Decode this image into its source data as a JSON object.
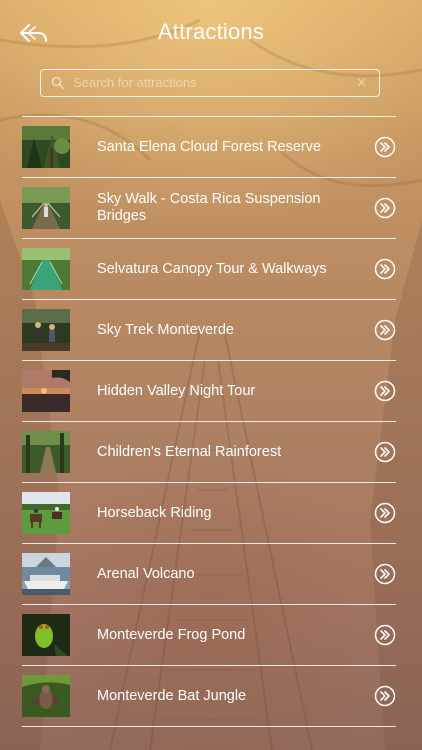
{
  "header": {
    "title": "Attractions",
    "back_icon": "back-arrow-icon"
  },
  "search": {
    "placeholder": "Search for attractions",
    "value": "",
    "icon": "search-icon",
    "clear_icon": "clear-icon"
  },
  "list": {
    "items": [
      {
        "label": "Santa Elena Cloud Forest Reserve",
        "thumb": "cloud-forest-photo"
      },
      {
        "label": "Sky Walk - Costa Rica Suspension Bridges",
        "thumb": "suspension-bridge-photo"
      },
      {
        "label": "Selvatura Canopy Tour & Walkways",
        "thumb": "canopy-walkway-photo"
      },
      {
        "label": "Sky Trek Monteverde",
        "thumb": "sky-trek-photo"
      },
      {
        "label": "Hidden Valley Night Tour",
        "thumb": "sunset-photo"
      },
      {
        "label": "Children's Eternal Rainforest",
        "thumb": "rainforest-path-photo"
      },
      {
        "label": "Horseback Riding",
        "thumb": "horseback-photo"
      },
      {
        "label": "Arenal Volcano",
        "thumb": "volcano-boat-photo"
      },
      {
        "label": "Monteverde Frog Pond",
        "thumb": "frog-photo"
      },
      {
        "label": "Monteverde Bat Jungle",
        "thumb": "bat-photo"
      }
    ],
    "row_icon": "double-chevron-right-icon"
  },
  "colors": {
    "text": "#ffffff",
    "divider": "#ffffff",
    "background_top": "#d8a968",
    "background_bottom": "#936a5b"
  }
}
